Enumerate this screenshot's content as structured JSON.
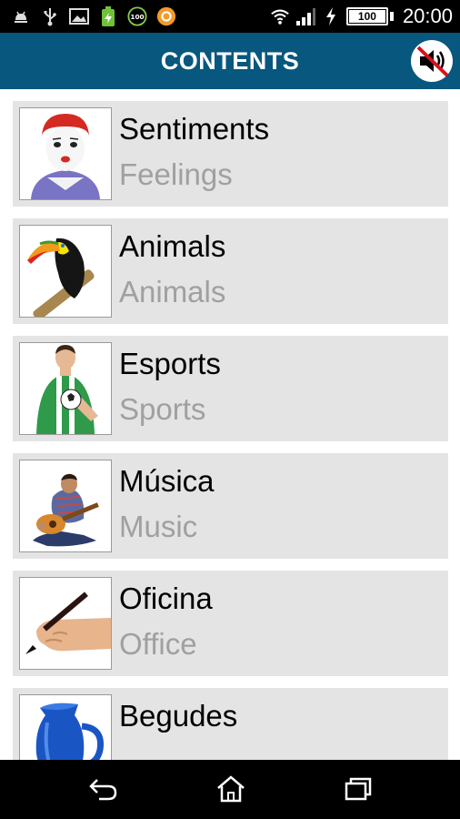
{
  "status_bar": {
    "time": "20:00",
    "battery_level": "100",
    "notification_icons": [
      "android-debug-icon",
      "usb-icon",
      "image-icon",
      "battery-app-icon",
      "100-badge-icon",
      "app-orange-icon"
    ]
  },
  "header": {
    "title": "CONTENTS",
    "mute_icon": "speaker-muted-icon"
  },
  "items": [
    {
      "title": "Sentiments",
      "subtitle": "Feelings",
      "image": "mime-face-image"
    },
    {
      "title": "Animals",
      "subtitle": "Animals",
      "image": "toucan-image"
    },
    {
      "title": "Esports",
      "subtitle": "Sports",
      "image": "soccer-player-image"
    },
    {
      "title": "Música",
      "subtitle": "Music",
      "image": "guitarist-image"
    },
    {
      "title": "Oficina",
      "subtitle": "Office",
      "image": "hand-pen-image"
    },
    {
      "title": "Begudes",
      "subtitle": "",
      "image": "blue-jug-image"
    }
  ],
  "nav": {
    "back_icon": "back-icon",
    "home_icon": "home-icon",
    "recents_icon": "recents-icon"
  },
  "colors": {
    "header_bg": "#07577e",
    "item_bg": "#e4e4e4",
    "subtitle": "#a0a0a0"
  }
}
